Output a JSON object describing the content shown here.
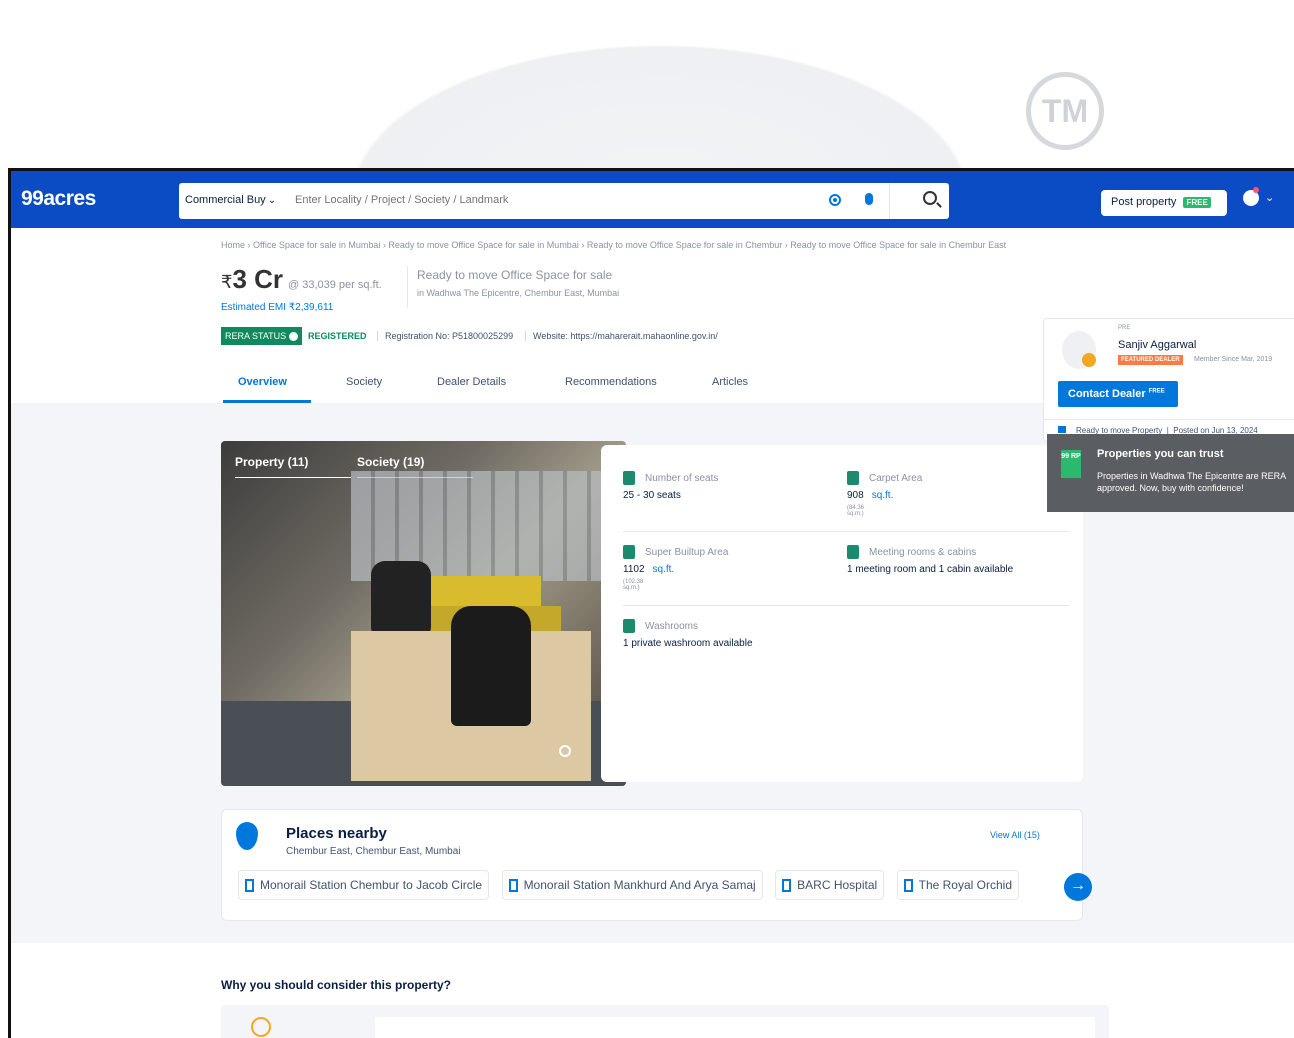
{
  "watermark": {
    "tm": "TM"
  },
  "topbar": {
    "logo": "99acres",
    "category": "Commercial Buy",
    "search_placeholder": "Enter Locality / Project / Society / Landmark",
    "post_property": "Post property",
    "free_badge": "FREE"
  },
  "breadcrumb": "Home › Office Space for sale in Mumbai › Ready to move Office Space for sale in Mumbai › Ready to move Office Space for sale in Chembur › Ready to move Office Space for sale in Chembur East",
  "property": {
    "currency": "₹",
    "price": "3 Cr",
    "price_per_sqft": "@ 33,039 per sq.ft.",
    "emi": "Estimated EMI ₹2,39,611",
    "title": "Ready to move Office Space for sale",
    "location": "in Wadhwa The Epicentre, Chembur East, Mumbai",
    "rera_status": "RERA STATUS",
    "registered": "REGISTERED",
    "registration_no": "Registration No: P51800025299",
    "website": "Website: https://maharerait.mahaonline.gov.in/"
  },
  "tabs": [
    "Overview",
    "Society",
    "Dealer Details",
    "Recommendations",
    "Articles"
  ],
  "dealer": {
    "tag": "PRE",
    "name": "Sanjiv Aggarwal",
    "featured": "FEATURED DEALER",
    "since": "Member Since Mar, 2019",
    "contact": "Contact Dealer",
    "contact_sup": "FREE",
    "status": "Ready to move Property",
    "posted": "Posted on Jun 13, 2024"
  },
  "gallery": {
    "property_tab": "Property (11)",
    "society_tab": "Society (19)"
  },
  "features": {
    "seats_label": "Number of seats",
    "seats_value": "25 - 30 seats",
    "carpet_label": "Carpet Area",
    "carpet_value": "908",
    "carpet_unit": "sq.ft.",
    "carpet_small": "(84.36 sq.m.)",
    "builtup_label": "Super Builtup Area",
    "builtup_value": "1102",
    "builtup_unit": "sq.ft.",
    "builtup_small": "(102.38 sq.m.)",
    "meeting_label": "Meeting rooms & cabins",
    "meeting_value": "1 meeting room and 1 cabin available",
    "washroom_label": "Washrooms",
    "washroom_value": "1 private washroom available"
  },
  "trust": {
    "badge": "99 RP",
    "title": "Properties you can trust",
    "body": "Properties in Wadhwa The Epicentre are RERA approved. Now, buy with confidence!"
  },
  "places": {
    "title": "Places nearby",
    "subtitle": "Chembur East, Chembur East, Mumbai",
    "view_all": "View All (15)",
    "chips": [
      "Monorail Station Chembur to Jacob Circle",
      "Monorail Station Mankhurd And Arya Samaj",
      "BARC Hospital",
      "The Royal Orchid"
    ]
  },
  "why": {
    "title": "Why you should consider this property?"
  }
}
